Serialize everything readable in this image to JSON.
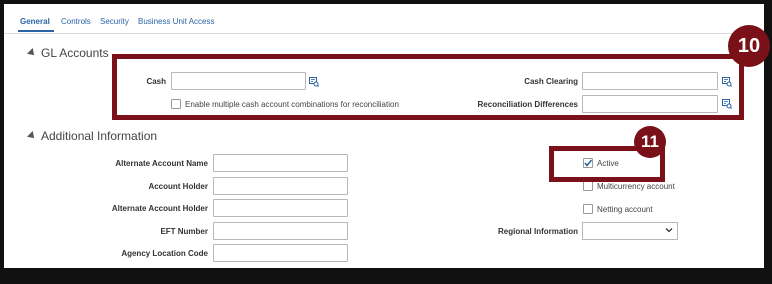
{
  "tabs": [
    {
      "label": "General"
    },
    {
      "label": "Controls"
    },
    {
      "label": "Security"
    },
    {
      "label": "Business Unit Access"
    }
  ],
  "gl_accounts": {
    "title": "GL Accounts",
    "cash_label": "Cash",
    "cash_value": "",
    "cash_clearing_label": "Cash Clearing",
    "cash_clearing_value": "",
    "multi_cash_label": "Enable multiple cash account combinations for reconciliation",
    "recon_diff_label": "Reconciliation Differences",
    "recon_diff_value": ""
  },
  "additional_info": {
    "title": "Additional Information",
    "alt_account_name_label": "Alternate Account Name",
    "account_holder_label": "Account Holder",
    "alt_account_holder_label": "Alternate Account Holder",
    "eft_number_label": "EFT Number",
    "agency_location_label": "Agency Location Code",
    "active_label": "Active",
    "active_checked": true,
    "multicurrency_label": "Multicurrency account",
    "netting_label": "Netting account",
    "regional_info_label": "Regional Information",
    "regional_info_value": ""
  },
  "callouts": {
    "badge_10": "10",
    "badge_11": "11"
  },
  "colors": {
    "accent": "#2b64a6",
    "callout": "#7a1119"
  },
  "icons": {
    "lookup": "search-lookup-icon",
    "collapse": "collapse-triangle-icon",
    "dropdown": "chevron-down-icon",
    "check": "checkmark-icon"
  }
}
